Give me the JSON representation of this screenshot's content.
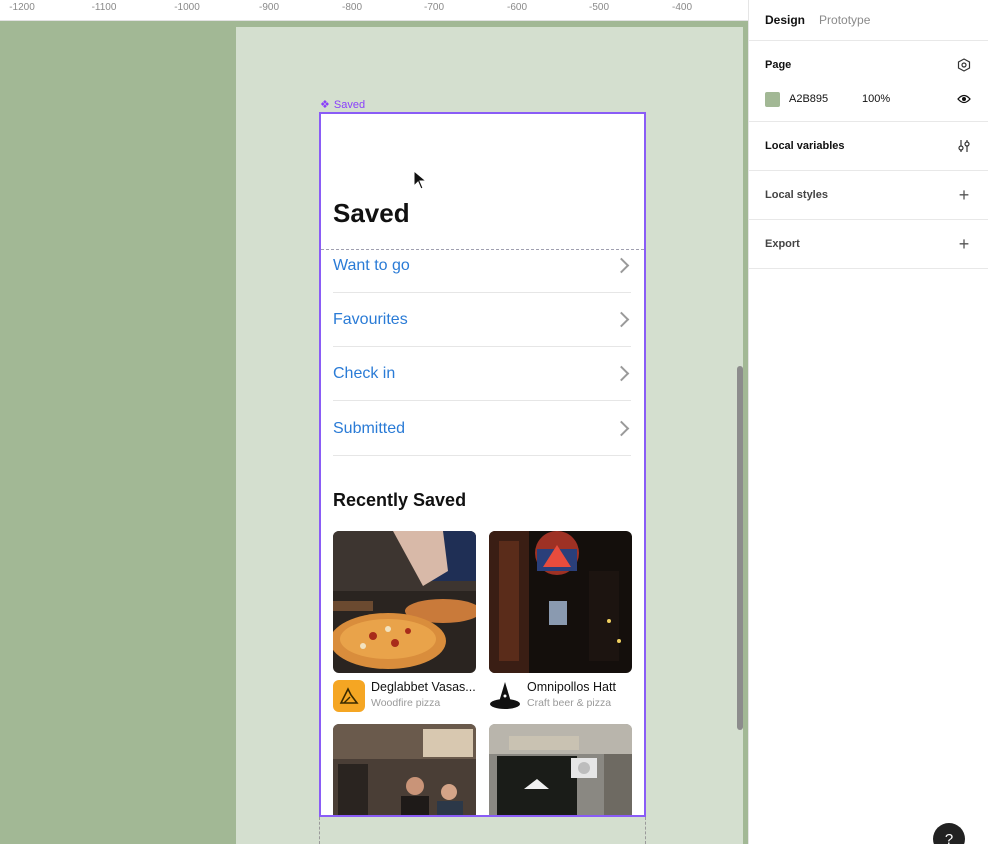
{
  "ruler": {
    "ticks": [
      "-1200",
      "-1100",
      "-1000",
      "-900",
      "-800",
      "-700",
      "-600",
      "-500",
      "-400"
    ]
  },
  "frame": {
    "label": "Saved"
  },
  "screen": {
    "title": "Saved",
    "lists": [
      {
        "label": "Want to go"
      },
      {
        "label": "Favourites"
      },
      {
        "label": "Check in"
      },
      {
        "label": "Submitted"
      }
    ],
    "recent_title": "Recently Saved",
    "cards": [
      {
        "name": "Deglabbet Vasas...",
        "category": "Woodfire pizza"
      },
      {
        "name": "Omnipollos Hatt",
        "category": "Craft beer & pizza"
      }
    ]
  },
  "panel": {
    "tabs": [
      "Design",
      "Prototype"
    ],
    "page": {
      "heading": "Page",
      "color": "A2B895",
      "opacity": "100%"
    },
    "local_variables": "Local variables",
    "local_styles": "Local styles",
    "export": "Export"
  },
  "colors": {
    "canvas": "#a2b895",
    "frame_selection": "#8a5cf6",
    "link": "#2a7bd6",
    "logo_orange": "#f5a623"
  },
  "help": "?"
}
